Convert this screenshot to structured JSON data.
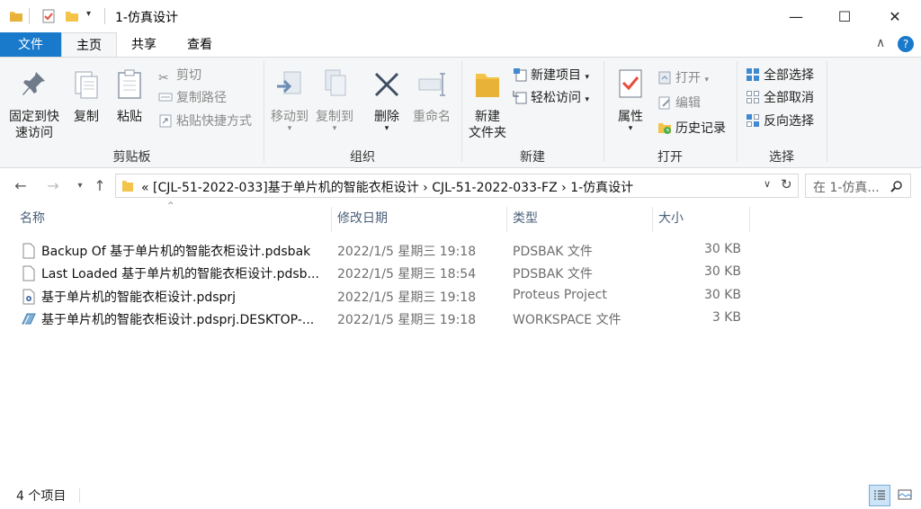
{
  "window": {
    "title": "1-仿真设计",
    "minimize_glyph": "—",
    "maximize_glyph": "☐",
    "close_glyph": "✕"
  },
  "tabs": [
    "文件",
    "主页",
    "共享",
    "查看"
  ],
  "ribbon": {
    "clipboard": {
      "group_label": "剪贴板",
      "pin_line1": "固定到快",
      "pin_line2": "速访问",
      "copy": "复制",
      "paste": "粘贴",
      "cut": "剪切",
      "copy_path": "复制路径",
      "paste_shortcut": "粘贴快捷方式"
    },
    "organize": {
      "group_label": "组织",
      "move_to": "移动到",
      "copy_to": "复制到",
      "delete": "删除",
      "rename": "重命名"
    },
    "new": {
      "group_label": "新建",
      "new_folder_line1": "新建",
      "new_folder_line2": "文件夹",
      "new_item": "新建项目",
      "easy_access": "轻松访问"
    },
    "open": {
      "group_label": "打开",
      "properties": "属性",
      "open": "打开",
      "edit": "编辑",
      "history": "历史记录"
    },
    "select": {
      "group_label": "选择",
      "select_all": "全部选择",
      "select_none": "全部取消",
      "invert": "反向选择"
    }
  },
  "address": {
    "crumbs": "«  [CJL-51-2022-033]基于单片机的智能衣柜设计  ›  CJL-51-2022-033-FZ  ›  1-仿真设计",
    "search_placeholder": "在 1-仿真..."
  },
  "columns": [
    "名称",
    "修改日期",
    "类型",
    "大小"
  ],
  "files": [
    {
      "name": "Backup Of 基于单片机的智能衣柜设计.pdsbak",
      "date": "2022/1/5 星期三 19:18",
      "type": "PDSBAK 文件",
      "size": "30 KB"
    },
    {
      "name": "Last Loaded 基于单片机的智能衣柜设计.pdsb...",
      "date": "2022/1/5 星期三 18:54",
      "type": "PDSBAK 文件",
      "size": "30 KB"
    },
    {
      "name": "基于单片机的智能衣柜设计.pdsprj",
      "date": "2022/1/5 星期三 19:18",
      "type": "Proteus Project",
      "size": "30 KB"
    },
    {
      "name": "基于单片机的智能衣柜设计.pdsprj.DESKTOP-...",
      "date": "2022/1/5 星期三 19:18",
      "type": "WORKSPACE 文件",
      "size": "3 KB"
    }
  ],
  "status": {
    "count": "4 个项目"
  },
  "colors": {
    "accent": "#1979ca",
    "folder": "#f3c34a"
  }
}
